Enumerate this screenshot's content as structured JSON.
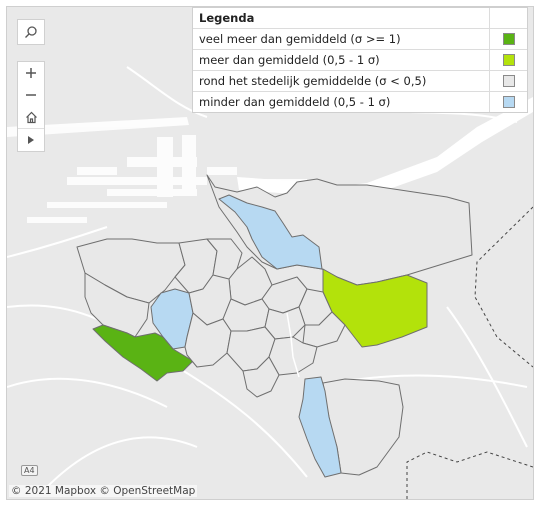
{
  "legend": {
    "title": "Legenda",
    "items": [
      {
        "label": "veel meer dan gemiddeld (σ >= 1)",
        "color": "#5ab314"
      },
      {
        "label": "meer dan gemiddeld (0,5 - 1 σ)",
        "color": "#b3e20b"
      },
      {
        "label": "rond het stedelijk gemiddelde (σ < 0,5)",
        "color": "#e8e8e8"
      },
      {
        "label": "minder dan gemiddeld (0,5 - 1 σ)",
        "color": "#b7d9f2"
      }
    ]
  },
  "toolbar": {
    "search_icon": "search-icon",
    "zoom_in_icon": "plus-icon",
    "zoom_out_icon": "minus-icon",
    "home_icon": "home-icon",
    "play_icon": "play-icon"
  },
  "attribution": "© 2021 Mapbox © OpenStreetMap",
  "road_label": "A4",
  "colors": {
    "background": "#ececec",
    "water": "#ffffff",
    "district_border": "#6f6f6f",
    "roads": "#ffffff"
  }
}
